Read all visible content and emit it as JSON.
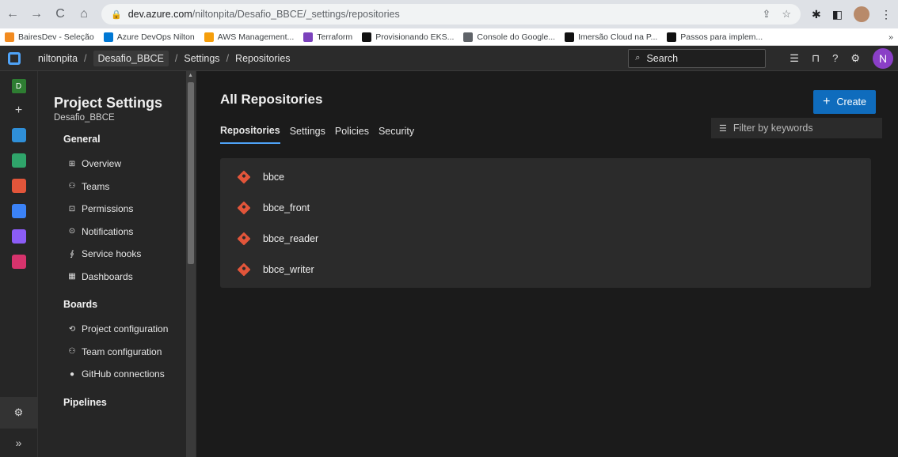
{
  "browser": {
    "url_host": "dev.azure.com",
    "url_path": "/niltonpita/Desafio_BBCE/_settings/repositories"
  },
  "bookmarks": [
    {
      "label": "BairesDev - Seleção",
      "color": "#f28b20"
    },
    {
      "label": "Azure DevOps Nilton",
      "color": "#0078d4"
    },
    {
      "label": "AWS Management...",
      "color": "#f59e0b"
    },
    {
      "label": "Terraform",
      "color": "#7b42bc"
    },
    {
      "label": "Provisionando EKS...",
      "color": "#111111"
    },
    {
      "label": "Console do Google...",
      "color": "#5f6368"
    },
    {
      "label": "Imersão Cloud na P...",
      "color": "#111111"
    },
    {
      "label": "Passos para implem...",
      "color": "#111111"
    }
  ],
  "header": {
    "org": "niltonpita",
    "project": "Desafio_BBCE",
    "section": "Settings",
    "page": "Repositories",
    "search_placeholder": "Search",
    "avatar_initial": "N"
  },
  "rail": {
    "project_initial": "D",
    "icons": [
      {
        "name": "overview-icon",
        "color": "#2f8fd8"
      },
      {
        "name": "boards-icon",
        "color": "#2fa46a"
      },
      {
        "name": "repos-icon",
        "color": "#e2553a"
      },
      {
        "name": "pipelines-icon",
        "color": "#3b82f6"
      },
      {
        "name": "test-plans-icon",
        "color": "#8b5cf6"
      },
      {
        "name": "artifacts-icon",
        "color": "#d6336c"
      }
    ]
  },
  "settings_nav": {
    "title": "Project Settings",
    "subtitle": "Desafio_BBCE",
    "sections": [
      {
        "heading": "General",
        "items": [
          {
            "label": "Overview",
            "icon": "⊞"
          },
          {
            "label": "Teams",
            "icon": "⚇"
          },
          {
            "label": "Permissions",
            "icon": "⊡"
          },
          {
            "label": "Notifications",
            "icon": "⊙"
          },
          {
            "label": "Service hooks",
            "icon": "∮"
          },
          {
            "label": "Dashboards",
            "icon": "▦"
          }
        ]
      },
      {
        "heading": "Boards",
        "items": [
          {
            "label": "Project configuration",
            "icon": "⟲"
          },
          {
            "label": "Team configuration",
            "icon": "⚇"
          },
          {
            "label": "GitHub connections",
            "icon": "●"
          }
        ]
      },
      {
        "heading": "Pipelines",
        "items": []
      }
    ]
  },
  "main": {
    "title": "All Repositories",
    "create_label": "Create",
    "tabs": [
      "Repositories",
      "Settings",
      "Policies",
      "Security"
    ],
    "filter_placeholder": "Filter by keywords",
    "repos": [
      "bbce",
      "bbce_front",
      "bbce_reader",
      "bbce_writer"
    ]
  }
}
